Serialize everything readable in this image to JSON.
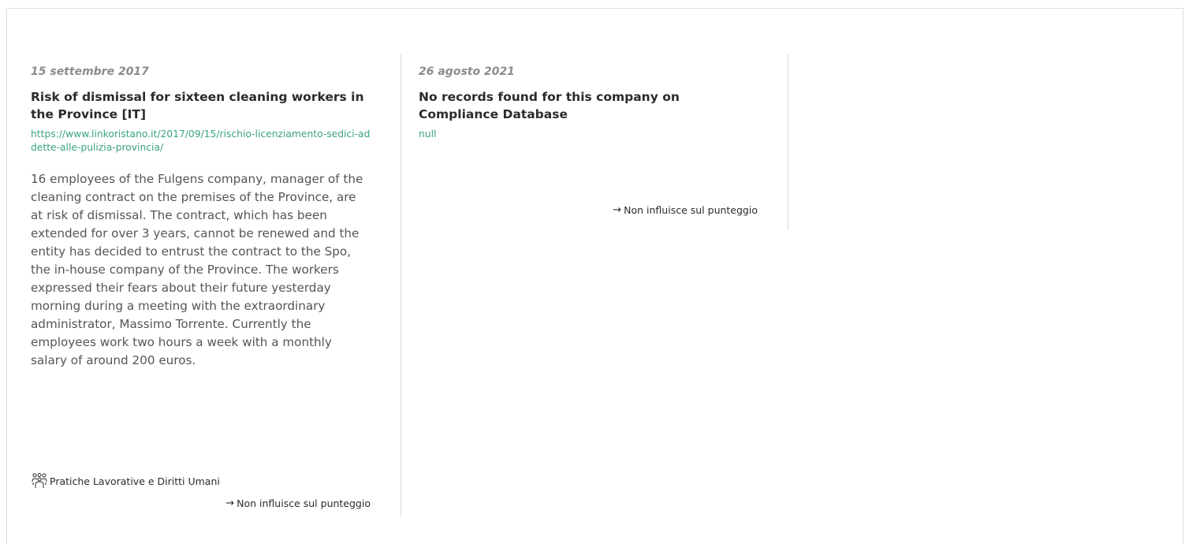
{
  "cards": [
    {
      "date": "15 settembre 2017",
      "title": "Risk of dismissal for sixteen cleaning workers in the Province [IT]",
      "url": "https://www.linkoristano.it/2017/09/15/rischio-licenziamento-sedici-addette-alle-pulizia-provincia/",
      "body": "16 employees of the Fulgens company, manager of the cleaning contract on the premises of the Province, are at risk of dismissal. The contract, which has been extended for over 3 years, cannot be renewed and the entity has decided to entrust the contract to the Spo, the in-house company of the Province. The workers expressed their fears about their future yesterday morning during a meeting with the extraordinary administrator, Massimo Torrente. Currently the employees work two hours a week with a monthly salary of around 200 euros.",
      "category": "Pratiche Lavorative e Diritti Umani",
      "category_icon": "people-group-icon",
      "impact": "Non influisce sul punteggio",
      "impact_icon": "arrow-right-icon"
    },
    {
      "date": "26 agosto 2021",
      "title": "No records found for this company on Compliance Database",
      "url": "null",
      "impact": "Non influisce sul punteggio",
      "impact_icon": "arrow-right-icon"
    }
  ],
  "colors": {
    "link": "#3aa37f",
    "date": "#8c8c8c",
    "divider": "#d9d9d9"
  }
}
